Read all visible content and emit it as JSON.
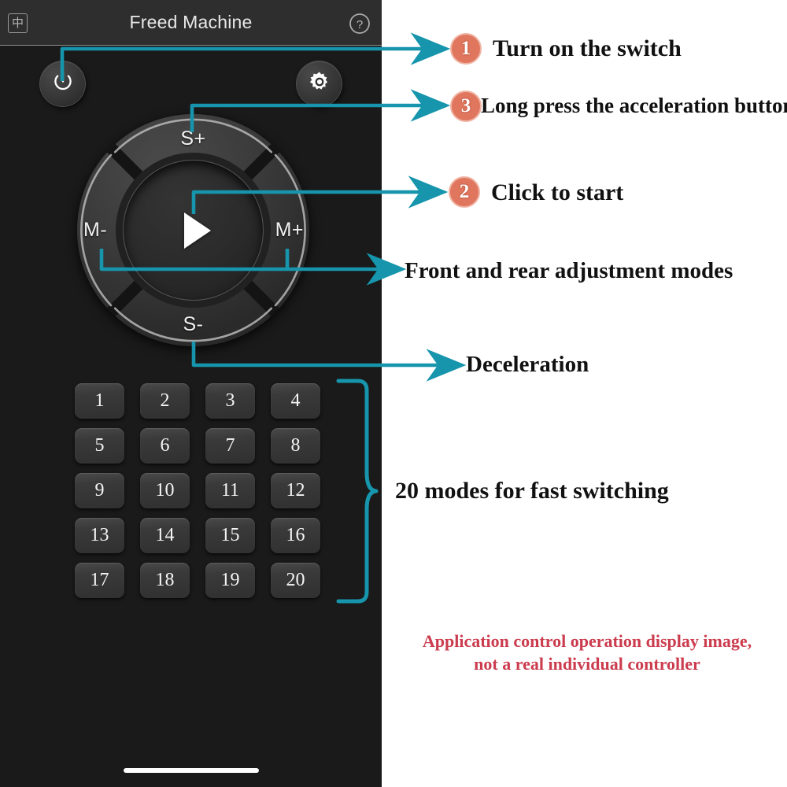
{
  "header": {
    "title": "Freed Machine",
    "lang_icon_label": "中",
    "lang_icon_name": "language-toggle-icon",
    "help_icon_name": "help-circle-icon"
  },
  "controls": {
    "power_icon_name": "power-icon",
    "gear_icon_name": "gear-icon",
    "dpad": {
      "top_label": "S+",
      "bottom_label": "S-",
      "left_label": "M-",
      "right_label": "M+",
      "center_icon_name": "play-icon"
    }
  },
  "mode_grid": {
    "buttons": [
      "1",
      "2",
      "3",
      "4",
      "5",
      "6",
      "7",
      "8",
      "9",
      "10",
      "11",
      "12",
      "13",
      "14",
      "15",
      "16",
      "17",
      "18",
      "19",
      "20"
    ]
  },
  "annotations": [
    {
      "badge": "1",
      "text": "Turn on the switch"
    },
    {
      "badge": "3",
      "text": "Long press the acceleration button"
    },
    {
      "badge": "2",
      "text": "Click to start"
    },
    {
      "badge": null,
      "text": "Front and rear adjustment modes"
    },
    {
      "badge": null,
      "text": "Deceleration"
    },
    {
      "badge": null,
      "text": "20 modes for fast switching"
    }
  ],
  "disclaimer": {
    "line1": "Application control operation display image,",
    "line2": "not a real individual controller"
  },
  "colors": {
    "accent_line": "#1695ac",
    "badge_fill": "#e0765e",
    "badge_ring": "#f0b3a3",
    "disclaimer": "#cb3c4e",
    "panel_bg": "#1a1a1a",
    "header_bg": "#2e2e2e"
  }
}
